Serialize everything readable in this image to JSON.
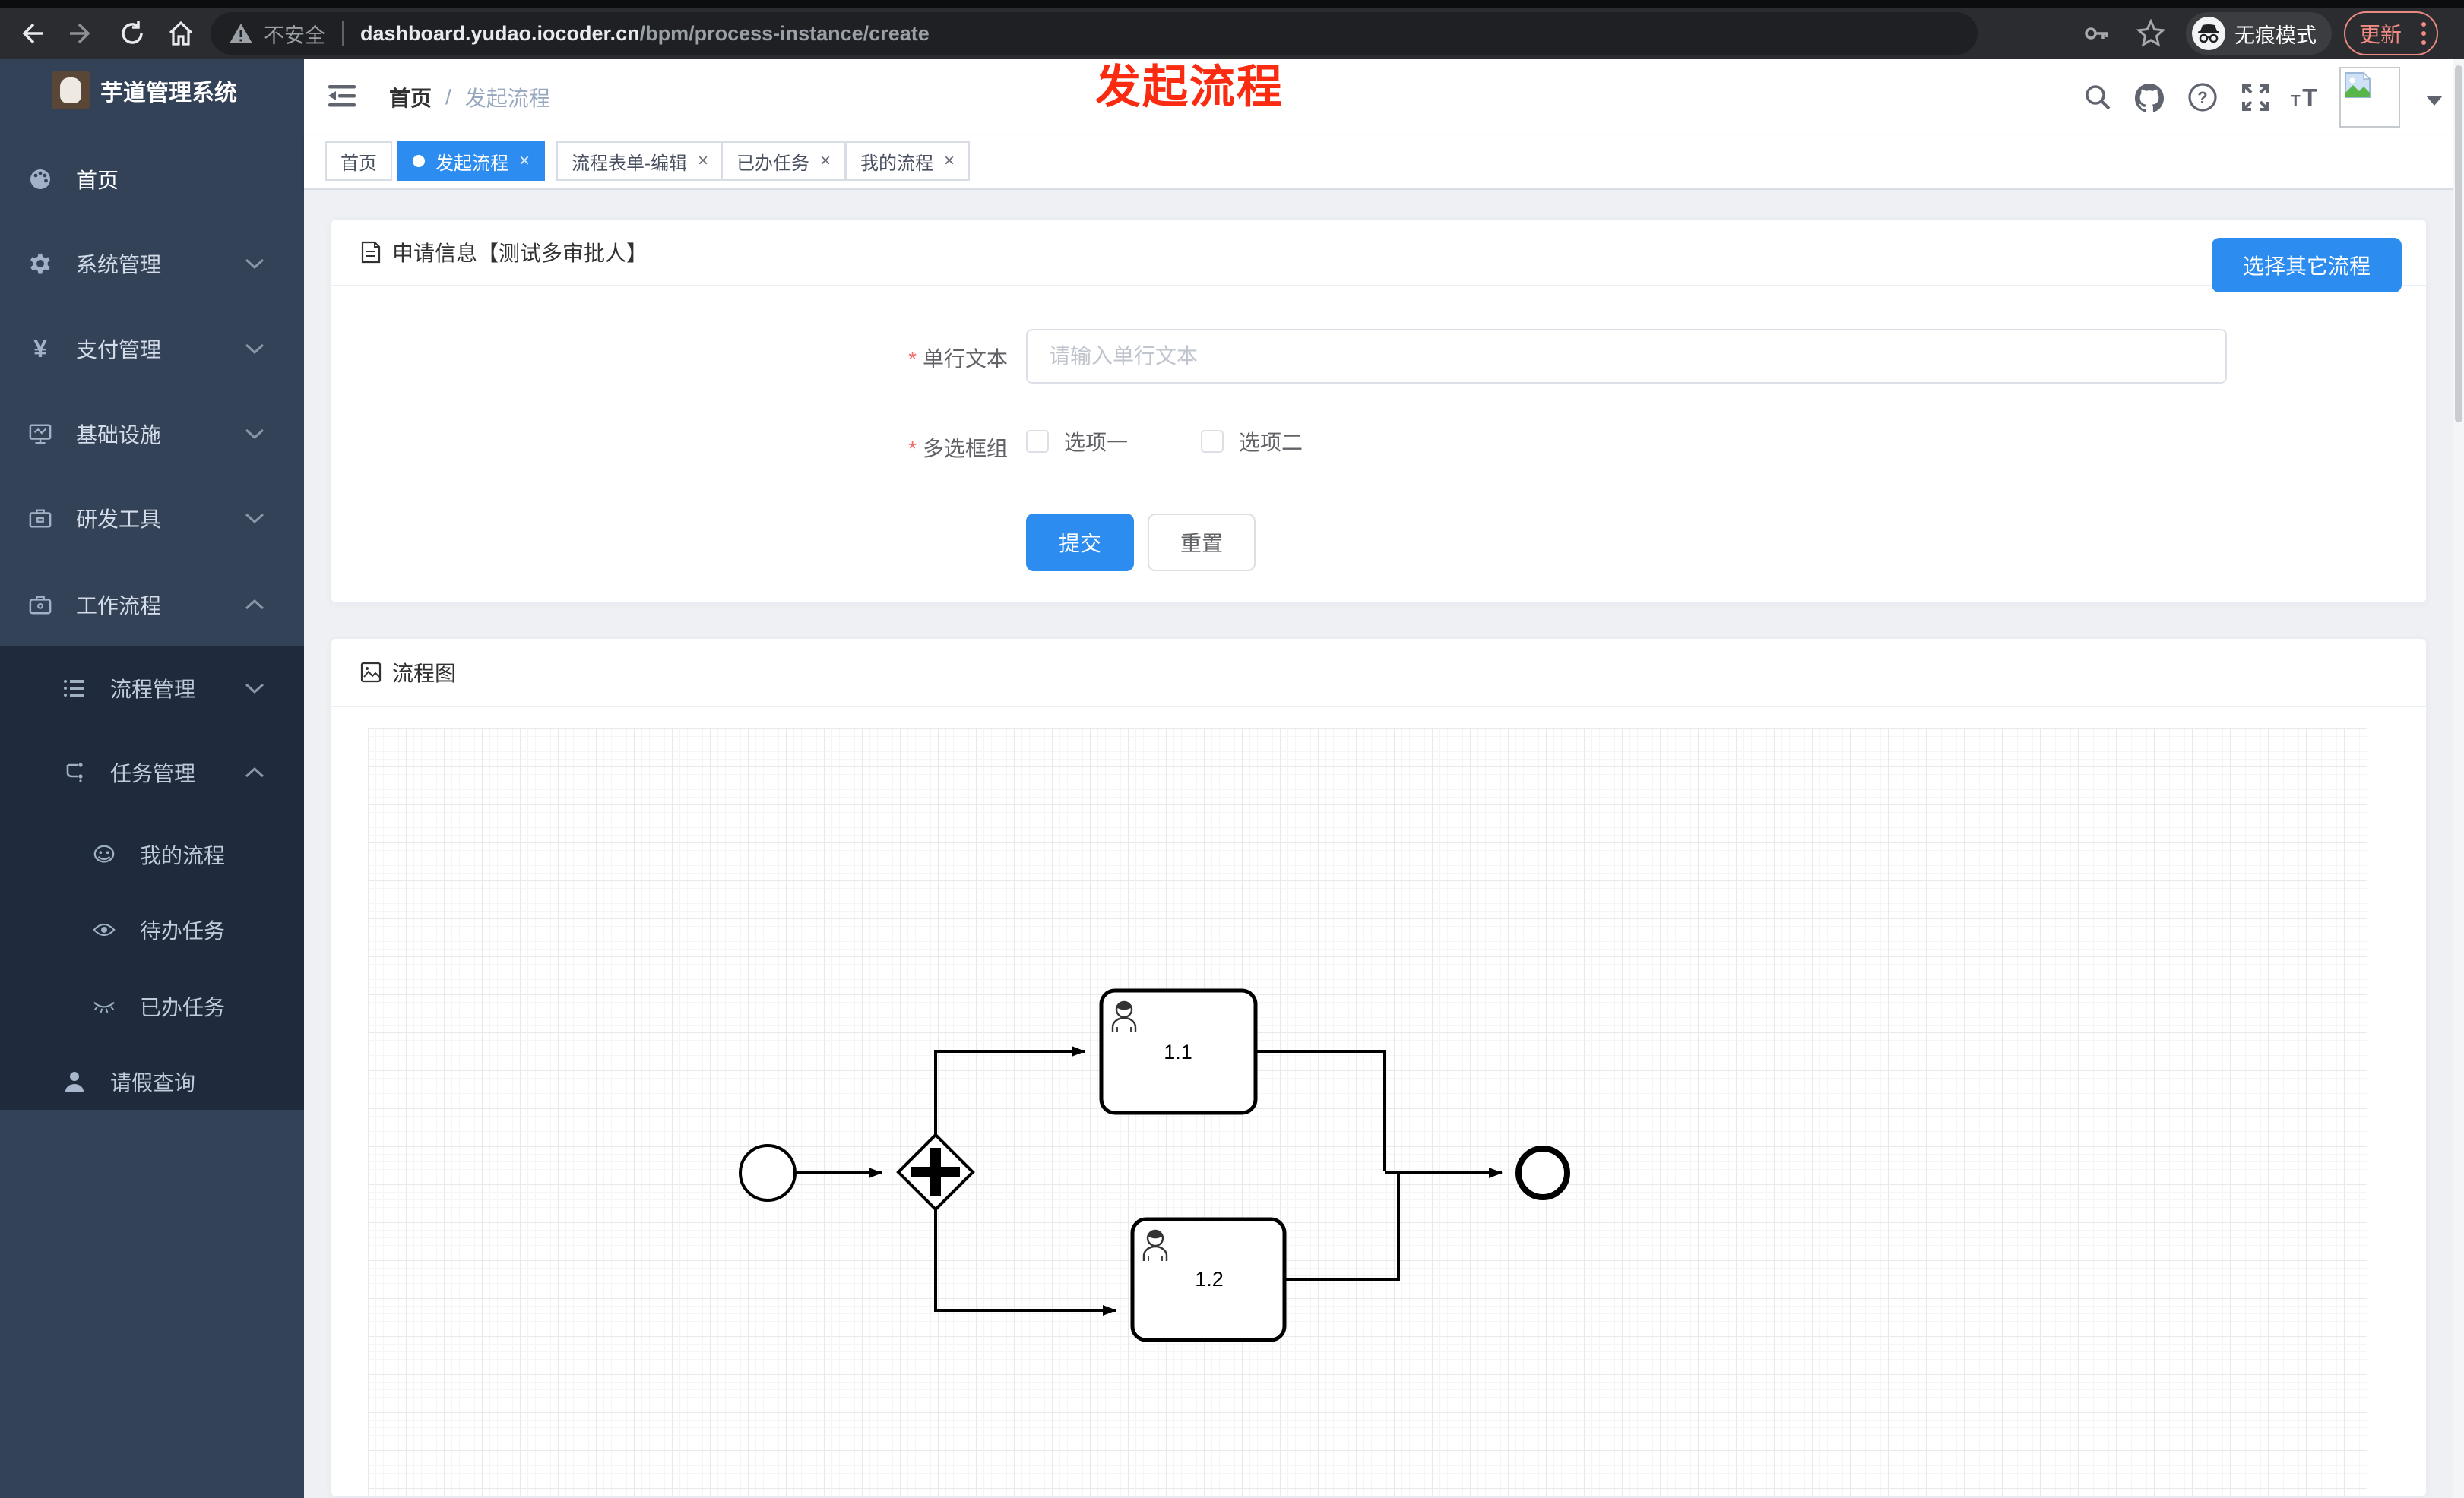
{
  "browser": {
    "security_label": "不安全",
    "url_host": "dashboard.yudao.iocoder.cn",
    "url_path": "/bpm/process-instance/create",
    "incognito_label": "无痕模式",
    "update_label": "更新"
  },
  "annotation": {
    "text": "发起流程"
  },
  "app": {
    "title": "芋道管理系统"
  },
  "sidebar": {
    "items": [
      {
        "label": "首页",
        "icon": "dashboard-icon"
      },
      {
        "label": "系统管理",
        "icon": "gear-icon"
      },
      {
        "label": "支付管理",
        "icon": "yen-icon",
        "glyph": "¥"
      },
      {
        "label": "基础设施",
        "icon": "monitor-icon"
      },
      {
        "label": "研发工具",
        "icon": "toolbox-icon"
      },
      {
        "label": "工作流程",
        "icon": "briefcase-icon"
      },
      {
        "label": "流程管理",
        "icon": "tree-icon"
      },
      {
        "label": "任务管理",
        "icon": "branch-icon"
      },
      {
        "label": "我的流程",
        "icon": "face-icon"
      },
      {
        "label": "待办任务",
        "icon": "eye-open-icon"
      },
      {
        "label": "已办任务",
        "icon": "eye-closed-icon"
      },
      {
        "label": "请假查询",
        "icon": "person-icon"
      }
    ]
  },
  "navbar": {
    "breadcrumb_home": "首页",
    "breadcrumb_sep": "/",
    "breadcrumb_current": "发起流程"
  },
  "tabs": {
    "close_glyph": "×",
    "items": [
      {
        "label": "首页",
        "active": false,
        "closable": false
      },
      {
        "label": "发起流程",
        "active": true,
        "closable": true
      },
      {
        "label": "流程表单-编辑",
        "active": false,
        "closable": true
      },
      {
        "label": "已办任务",
        "active": false,
        "closable": true
      },
      {
        "label": "我的流程",
        "active": false,
        "closable": true
      }
    ]
  },
  "form": {
    "title": "申请信息【测试多审批人】",
    "switch_button": "选择其它流程",
    "required_mark": "*",
    "fields": [
      {
        "label": "单行文本",
        "placeholder": "请输入单行文本",
        "value": "",
        "required": true
      },
      {
        "label": "多选框组",
        "required": true,
        "options": [
          {
            "label": "选项一",
            "checked": false
          },
          {
            "label": "选项二",
            "checked": false
          }
        ]
      }
    ],
    "submit_label": "提交",
    "reset_label": "重置"
  },
  "flow": {
    "title": "流程图",
    "diagram": {
      "type": "bpmn",
      "nodes": [
        {
          "id": "start",
          "type": "start-event"
        },
        {
          "id": "gateway",
          "type": "parallel-gateway"
        },
        {
          "id": "task-1-1",
          "type": "user-task",
          "label": "1.1"
        },
        {
          "id": "task-1-2",
          "type": "user-task",
          "label": "1.2"
        },
        {
          "id": "end",
          "type": "end-event"
        }
      ],
      "flows": [
        "start -> gateway",
        "gateway -> task-1-1",
        "gateway -> task-1-2",
        "task-1-1 -> end",
        "task-1-2 -> end"
      ]
    }
  },
  "colors": {
    "primary": "#2d8cf0",
    "annotation_red": "#fa2b10",
    "sidebar_bg": "#344258",
    "sidebar_submenu_bg": "#1f2b3c",
    "content_bg": "#eef0f4",
    "chrome_update": "#f28b82"
  }
}
